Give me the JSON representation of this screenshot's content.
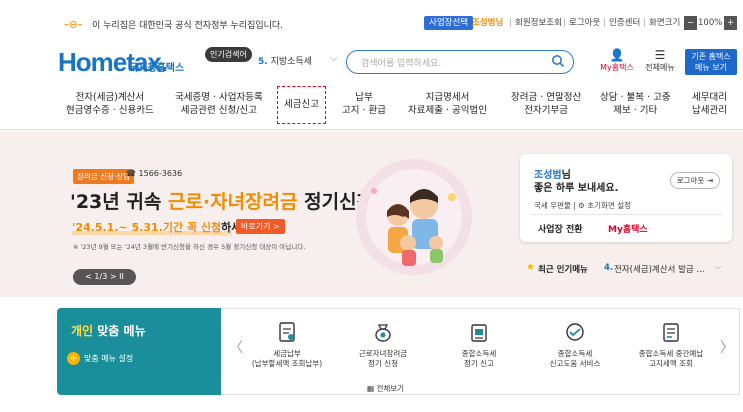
{
  "gov": {
    "mark": "-⊖-",
    "text": "이 누리집은 대한민국 공식 전자정부 누리집입니다."
  },
  "util": {
    "business_select": "사업장선택",
    "user_name": "조성범님",
    "member_info": "회원정보조회",
    "logout": "로그아웃",
    "cert_center": "인증센터",
    "screen_size": "화면크기",
    "zoom": "100%"
  },
  "logo": {
    "brand": "Hometax.",
    "name": "국세청홈택스"
  },
  "search": {
    "popular_badge": "인기검색어",
    "popular_rank": "5.",
    "popular_term": "지방소득세",
    "placeholder": "검색어를 입력하세요."
  },
  "header_right": {
    "my_label": "My홈택스",
    "menu_label": "전체메뉴",
    "classic_line1": "기존 홈택스",
    "classic_line2": "메뉴 보기"
  },
  "gnb": [
    {
      "l1": "전자(세금)계산서",
      "l2": "현금영수증 · 신용카드"
    },
    {
      "l1": "국세증명 · 사업자등록",
      "l2": "세금관련 신청/신고"
    },
    {
      "l1": "세금신고",
      "l2": ""
    },
    {
      "l1": "납부",
      "l2": "고지 · 환급"
    },
    {
      "l1": "지급명세서",
      "l2": "자료제출 · 공익법인"
    },
    {
      "l1": "장려금 · 연말정산",
      "l2": "전자기부금"
    },
    {
      "l1": "상담 · 불복 · 고충",
      "l2": "제보 · 기타"
    },
    {
      "l1": "세무대리",
      "l2": "납세관리"
    }
  ],
  "hero": {
    "badge": "장려금 신청·상담",
    "phone": "☎ 1566-3636",
    "title_pre": "'23년 귀속 ",
    "title_hl": "근로·자녀장려금",
    "title_post": " 정기신청",
    "period_hl": "'24.5.1.~ 5.31.기간 꼭 신청",
    "period_post": "하세요!",
    "goto": "바로가기 >",
    "note": "※ '23년 9월 또는 '24년 3월에 반기신청을 하신 경우 5월 정기신청 대상이 아닙니다.",
    "pager": "< 1/3 >  II"
  },
  "user_card": {
    "name": "조성범",
    "name_suffix": "님",
    "greeting": "좋은 하루 보내세요.",
    "logout": "로그아웃 ⇥",
    "links": "국세 우편물 | ⚙ 초기화면 설정",
    "switch": "사업장 전환",
    "myhome": "My홈택스"
  },
  "popular_menu": {
    "title": "최근 인기메뉴",
    "num": "4.",
    "item": "전자(세금)계산서 발급 ..."
  },
  "personal": {
    "title_pre": "개인",
    "title_post": " 맞춤 메뉴",
    "settings": "맞춤 메뉴 설정",
    "plus_glyph": "+"
  },
  "services": [
    {
      "l1": "세금납부",
      "l2": "(납부할세액 조회납부)"
    },
    {
      "l1": "근로자녀장려금",
      "l2": "정기 신청"
    },
    {
      "l1": "종합소득세",
      "l2": "정기 신고"
    },
    {
      "l1": "종합소득세",
      "l2": "신고도움 서비스"
    },
    {
      "l1": "종합소득세 중간예납",
      "l2": "고지세액 조회"
    }
  ],
  "view_all": "전체보기",
  "icons": {
    "search": "search-icon",
    "person": "person-icon",
    "hamburger": "hamburger-icon",
    "star": "star-icon"
  },
  "colors": {
    "primary": "#1a74c4",
    "accent": "#f28c00",
    "teal": "#1a8e9a",
    "red": "#e0002a"
  }
}
